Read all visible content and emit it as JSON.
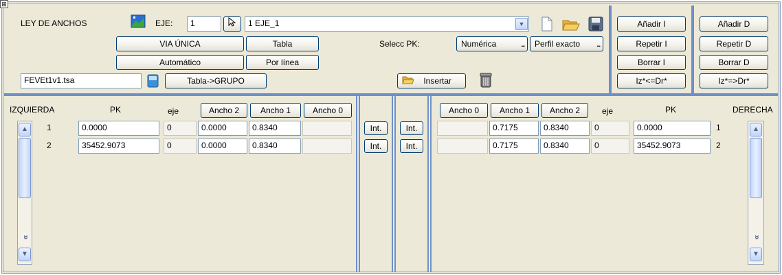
{
  "header": {
    "title": "LEY DE ANCHOS",
    "eje_label": "EJE:",
    "eje_value": "1",
    "eje_select": "1 EJE_1",
    "via_unica": "VIA ÚNICA",
    "tabla": "Tabla",
    "automatico": "Automático",
    "por_linea": "Por línea",
    "selecc_pk": "Selecc PK:",
    "numerica": "Numérica",
    "perfil_exacto": "Perfil exacto",
    "file": "FEVEt1v1.tsa",
    "tabla_grupo": "Tabla->GRUPO",
    "insertar": "Insertar",
    "ellipsis": "..."
  },
  "actions_left": [
    "Añadir I",
    "Repetir I",
    "Borrar I",
    "Iz*<=Dr*"
  ],
  "actions_right": [
    "Añadir D",
    "Repetir D",
    "Borrar D",
    "Iz*=>Dr*"
  ],
  "left": {
    "title": "IZQUIERDA",
    "pk": "PK",
    "eje": "eje",
    "ancho2": "Ancho 2",
    "ancho1": "Ancho 1",
    "ancho0": "Ancho 0",
    "rows": [
      {
        "n": "1",
        "pk": "0.0000",
        "eje": "0",
        "a2": "0.0000",
        "a1": "0.8340",
        "a0": ""
      },
      {
        "n": "2",
        "pk": "35452.9073",
        "eje": "0",
        "a2": "0.0000",
        "a1": "0.8340",
        "a0": ""
      }
    ]
  },
  "int_label": "Int.",
  "right": {
    "title": "DERECHA",
    "pk": "PK",
    "eje": "eje",
    "ancho0": "Ancho 0",
    "ancho1": "Ancho 1",
    "ancho2": "Ancho 2",
    "rows": [
      {
        "n": "1",
        "pk": "0.0000",
        "eje": "0",
        "a2": "0.8340",
        "a1": "0.7175",
        "a0": ""
      },
      {
        "n": "2",
        "pk": "35452.9073",
        "eje": "0",
        "a2": "0.8340",
        "a1": "0.7175",
        "a0": ""
      }
    ]
  },
  "icons": {
    "window": "pin-icon",
    "info": "info-graphic-icon",
    "pointer": "cursor-icon",
    "dropdown": "chevron-down-icon",
    "new": "new-file-icon",
    "open": "open-folder-icon",
    "save": "save-disk-icon",
    "book": "book-icon",
    "insert": "folder-insert-icon",
    "trash": "trash-icon"
  },
  "colors": {
    "border": "#7f9db9",
    "panel": "#ece9d8",
    "button_border": "#003c74",
    "separator": "#6f8fc8"
  }
}
